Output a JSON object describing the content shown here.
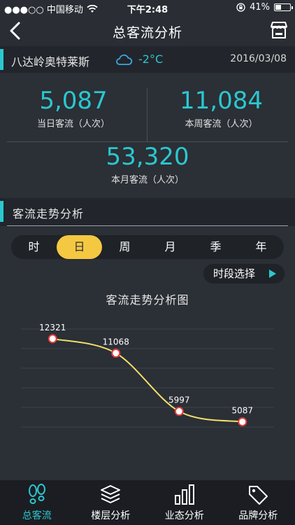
{
  "status_bar": {
    "carrier": "●●●○○ 中国移动",
    "time": "下午2:48",
    "battery": "41%",
    "battery_level": 0.41
  },
  "nav": {
    "title": "总客流分析",
    "back_icon": "chevron-left-icon",
    "store_icon": "store-icon"
  },
  "location": {
    "name": "八达岭奥特莱斯",
    "weather_icon": "cloud-icon",
    "temperature": "-2°C",
    "date": "2016/03/08"
  },
  "stats": {
    "daily": {
      "value": "5,087",
      "label": "当日客流（人次）"
    },
    "weekly": {
      "value": "11,084",
      "label": "本周客流（人次）"
    },
    "monthly": {
      "value": "53,320",
      "label": "本月客流（人次）"
    }
  },
  "trend": {
    "section_title": "客流走势分析",
    "granularity": [
      "时",
      "日",
      "周",
      "月",
      "季",
      "年"
    ],
    "selected_index": 1,
    "period_button": "时段选择"
  },
  "chart_data": {
    "type": "line",
    "title": "客流走势分析图",
    "x": [
      1,
      2,
      3,
      4
    ],
    "values": [
      12321,
      11068,
      5997,
      5087
    ],
    "labels": [
      "12321",
      "11068",
      "5997",
      "5087"
    ],
    "ylim": [
      0,
      15000
    ],
    "grid": true,
    "line_color": "#f2e06a",
    "marker_color": "#e23c3c",
    "grid_color": "#3e434b"
  },
  "tabs": [
    {
      "label": "总客流",
      "icon": "footprints-icon",
      "active": true
    },
    {
      "label": "楼层分析",
      "icon": "layers-icon",
      "active": false
    },
    {
      "label": "业态分析",
      "icon": "bar-chart-icon",
      "active": false
    },
    {
      "label": "品牌分析",
      "icon": "tag-icon",
      "active": false
    }
  ],
  "colors": {
    "accent": "#2bc7cf",
    "highlight": "#f5c842",
    "background": "#2b2f36"
  }
}
